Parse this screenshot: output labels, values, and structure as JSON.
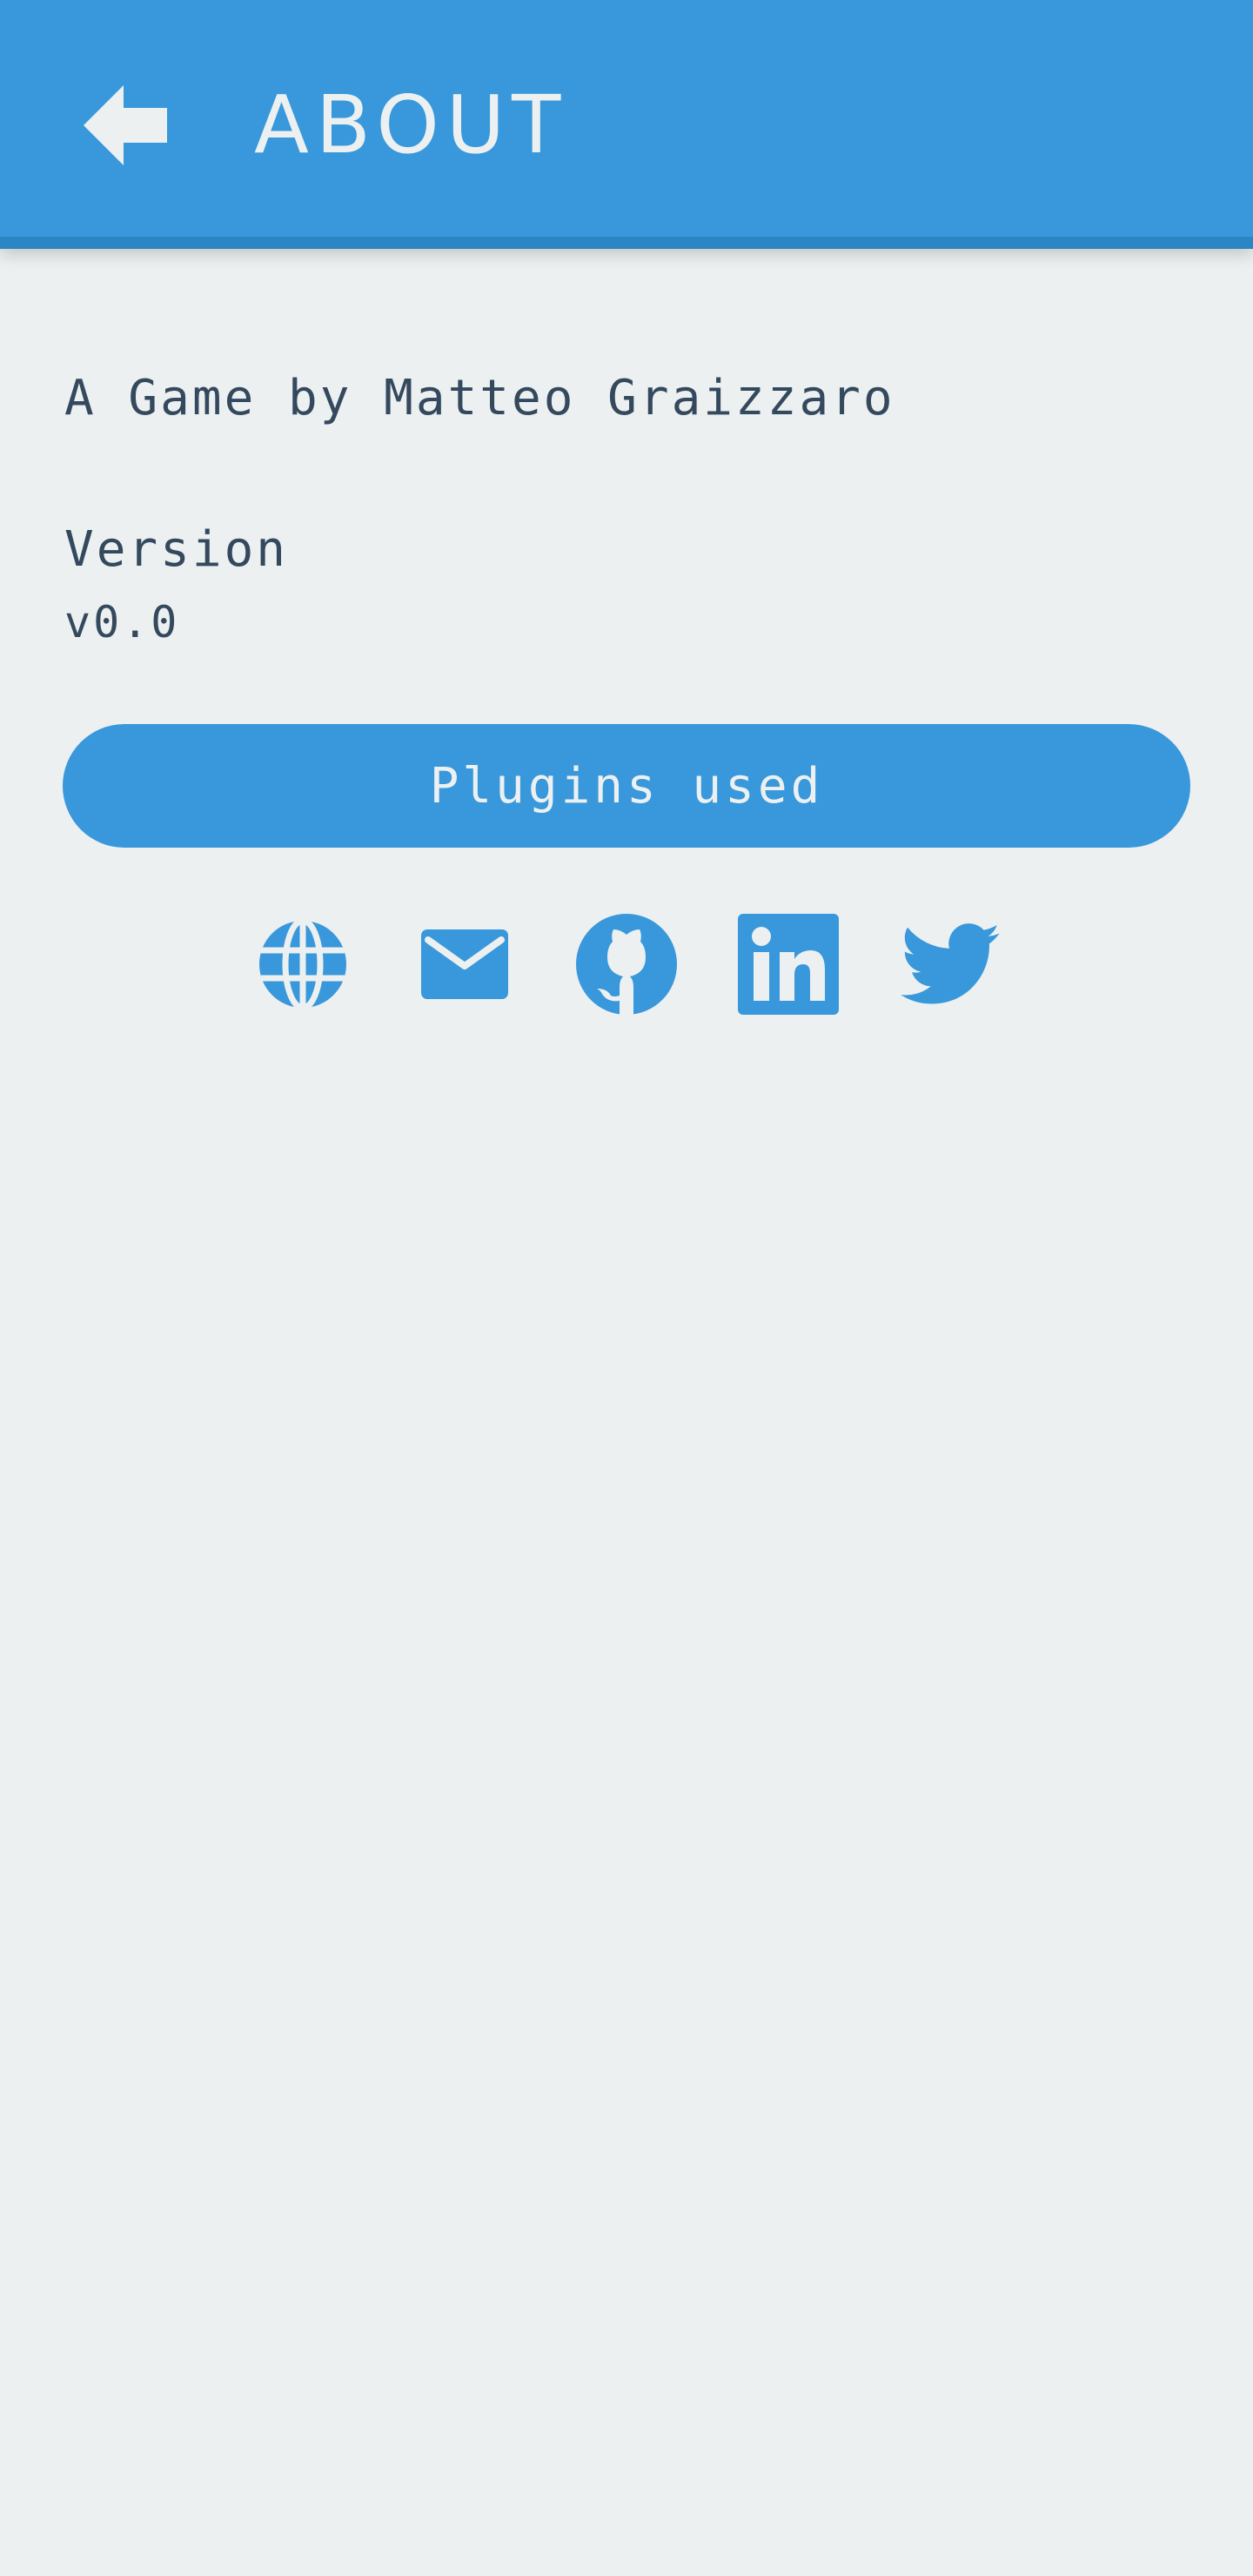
{
  "app_bar": {
    "title": "ABOUT",
    "back_icon": "arrow-left-icon"
  },
  "about": {
    "author": "A Game by Matteo Graizzaro",
    "version_label": "Version",
    "version_value": "v0.0"
  },
  "plugins_button": {
    "label": "Plugins used"
  },
  "social_links": [
    {
      "icon": "globe-icon"
    },
    {
      "icon": "email-icon"
    },
    {
      "icon": "github-icon"
    },
    {
      "icon": "linkedin-icon"
    },
    {
      "icon": "twitter-icon"
    }
  ],
  "colors": {
    "primary": "#3898db",
    "primary_dark": "#2d86c4",
    "background": "#ecf0f1",
    "text": "#34495e",
    "on_primary": "#ecf0f1"
  }
}
